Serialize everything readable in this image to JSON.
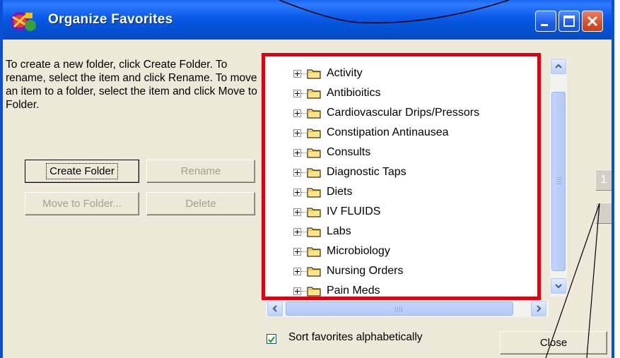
{
  "window": {
    "title": "Organize Favorites",
    "instructions": "To create a new folder, click Create Folder.  To rename, select the item and click Rename.  To move an item to a folder, select the item and click Move to Folder."
  },
  "buttons": {
    "create_folder": "Create Folder",
    "rename": "Rename",
    "move_to_folder": "Move to Folder...",
    "delete": "Delete",
    "close": "Close"
  },
  "tree": {
    "items": [
      {
        "label": "Activity"
      },
      {
        "label": "Antibioitics"
      },
      {
        "label": "Cardiovascular Drips/Pressors"
      },
      {
        "label": "Constipation Antinausea"
      },
      {
        "label": "Consults"
      },
      {
        "label": "Diagnostic Taps"
      },
      {
        "label": "Diets"
      },
      {
        "label": "IV FLUIDS"
      },
      {
        "label": "Labs"
      },
      {
        "label": "Microbiology"
      },
      {
        "label": "Nursing Orders"
      },
      {
        "label": "Pain Meds"
      }
    ]
  },
  "options": {
    "sort_label": "Sort favorites alphabetically",
    "sort_checked": true
  },
  "page_buttons": {
    "first": "1",
    "second": ""
  },
  "colors": {
    "titlebar": "#0a59e8",
    "highlight_border": "#e1000f",
    "window_bg": "#ece9d8"
  }
}
